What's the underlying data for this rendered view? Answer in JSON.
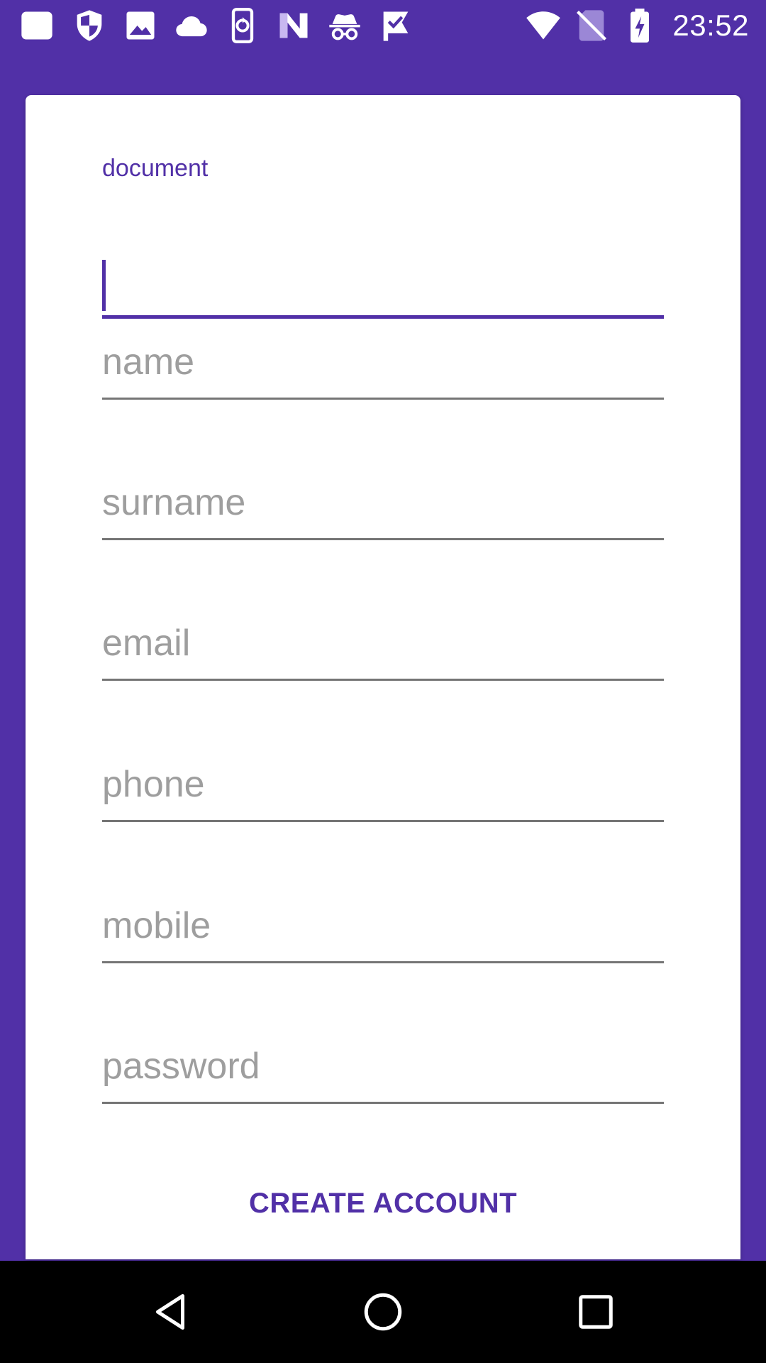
{
  "status_bar": {
    "time": "23:52",
    "left_icons": [
      "app-square-icon",
      "shield-icon",
      "image-icon",
      "cloud-icon",
      "phone-sync-icon",
      "n-logo-icon",
      "incognito-icon",
      "check-flag-icon"
    ],
    "right_icons": [
      "wifi-icon",
      "no-sim-icon",
      "battery-charging-icon"
    ]
  },
  "form": {
    "document": {
      "label": "document",
      "value": ""
    },
    "name": {
      "placeholder": "name"
    },
    "surname": {
      "placeholder": "surname"
    },
    "email": {
      "placeholder": "email"
    },
    "phone": {
      "placeholder": "phone"
    },
    "mobile": {
      "placeholder": "mobile"
    },
    "password": {
      "placeholder": "password"
    },
    "submit_label": "CREATE ACCOUNT"
  },
  "nav_bar": {
    "icons": [
      "back-icon",
      "home-icon",
      "recents-icon"
    ]
  },
  "colors": {
    "primary": "#5130a7",
    "card": "#ffffff",
    "placeholder": "#9e9e9e",
    "nav_bar": "#000000"
  }
}
